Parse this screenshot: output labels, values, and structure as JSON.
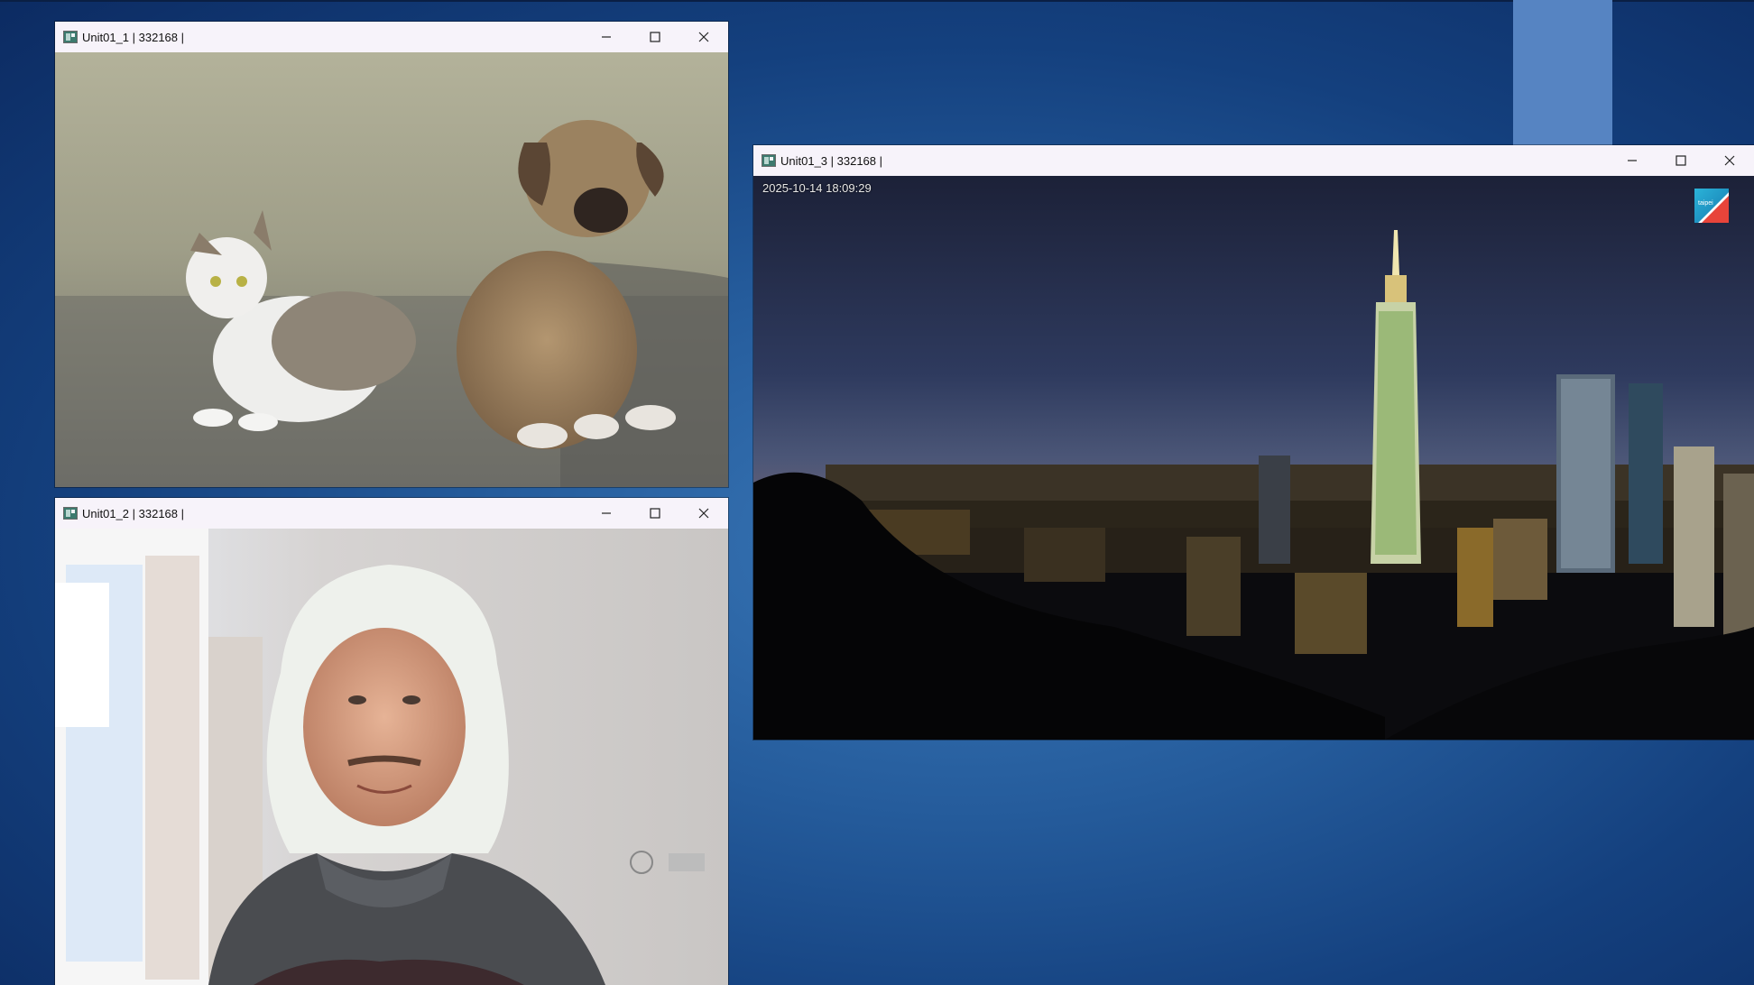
{
  "windows": [
    {
      "id": "unit1",
      "title": "Unit01_1 | 332168 |",
      "image": "cat-and-puppy-photo"
    },
    {
      "id": "unit2",
      "title": "Unit01_2 | 332168 |",
      "image": "webcam-person-photo"
    },
    {
      "id": "unit3",
      "title": "Unit01_3 | 332168 |",
      "image": "taipei-night-skyline-camera",
      "timestamp": "2025-10-14 18:09:29",
      "logo_text": "taipei"
    }
  ],
  "controls": {
    "minimize_icon": "minimize-icon",
    "maximize_icon": "maximize-icon",
    "close_icon": "close-icon"
  },
  "colors": {
    "desktop": "#14407e",
    "titlebar": "#f7f3fa"
  }
}
